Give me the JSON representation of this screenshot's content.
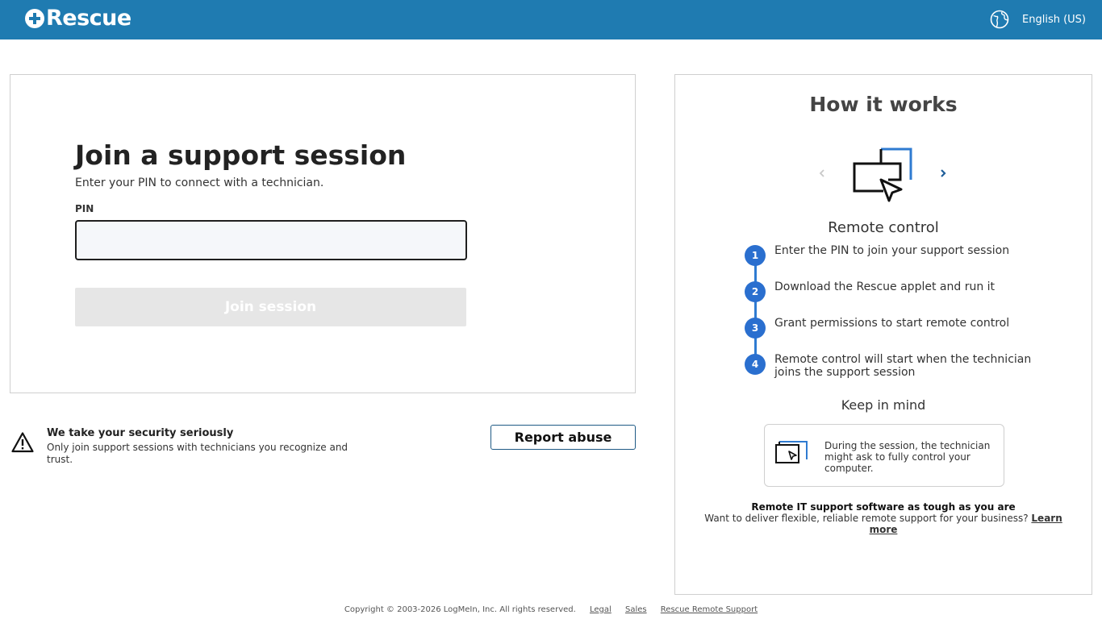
{
  "header": {
    "logo_text": "Rescue",
    "language": "English (US)",
    "icons": {
      "logo": "plus-circle-icon",
      "language": "globe-icon"
    }
  },
  "join": {
    "title": "Join a support session",
    "subtitle": "Enter your PIN to connect with a technician.",
    "pin_label": "PIN",
    "pin_value": "",
    "join_button": "Join session",
    "join_button_disabled": true
  },
  "security": {
    "icon": "warning-icon",
    "title": "We take your security seriously",
    "text": "Only join support sessions with technicians you recognize and trust.",
    "report_button": "Report abuse"
  },
  "how_it_works": {
    "title": "How it works",
    "slide_title": "Remote control",
    "slide_icon": "remote-control-icon",
    "steps": [
      {
        "num": "1",
        "text": "Enter the PIN to join your support session"
      },
      {
        "num": "2",
        "text": "Download the Rescue applet and run it"
      },
      {
        "num": "3",
        "text": "Grant permissions to start remote control"
      },
      {
        "num": "4",
        "text": "Remote control will start when the technician joins the support session"
      }
    ],
    "keep_in_mind_title": "Keep in mind",
    "keep_in_mind_text": "During the session, the technician might ask to fully control your computer.",
    "promo_title": "Remote IT support software as tough as you are",
    "promo_text": "Want to deliver flexible, reliable remote support for your business?",
    "promo_link": "Learn more"
  },
  "footer": {
    "copyright": "Copyright © 2003-2026 LogMeIn, Inc. All rights reserved.",
    "links": [
      "Legal",
      "Sales",
      "Rescue Remote Support"
    ]
  },
  "colors": {
    "header_bg": "#1f7bb1",
    "step_accent": "#2a6fcf",
    "disabled_button": "#e6e6e6"
  }
}
